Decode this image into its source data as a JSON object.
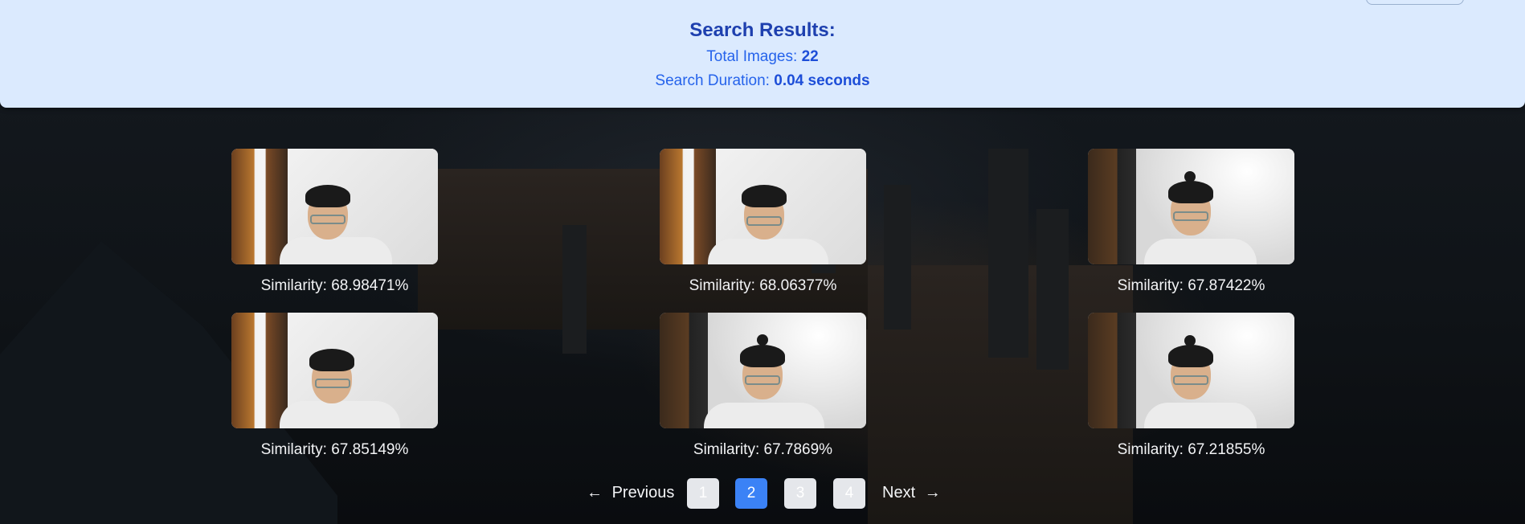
{
  "header": {
    "title": "Search Results:",
    "total_label": "Total Images: ",
    "total_value": "22",
    "duration_label": "Search Duration: ",
    "duration_value": "0.04 seconds"
  },
  "results": [
    {
      "similarity": "Similarity: 68.98471%"
    },
    {
      "similarity": "Similarity: 68.06377%"
    },
    {
      "similarity": "Similarity: 67.87422%"
    },
    {
      "similarity": "Similarity: 67.85149%"
    },
    {
      "similarity": "Similarity: 67.7869%"
    },
    {
      "similarity": "Similarity: 67.21855%"
    }
  ],
  "pagination": {
    "previous_label": "Previous",
    "next_label": "Next",
    "pages": [
      "1",
      "2",
      "3",
      "4"
    ],
    "current_page": "2",
    "previous_icon": "arrow-left-icon",
    "next_icon": "arrow-right-icon"
  },
  "colors": {
    "header_bg": "#dbeafe",
    "title": "#1e40af",
    "accent": "#3b82f6"
  }
}
